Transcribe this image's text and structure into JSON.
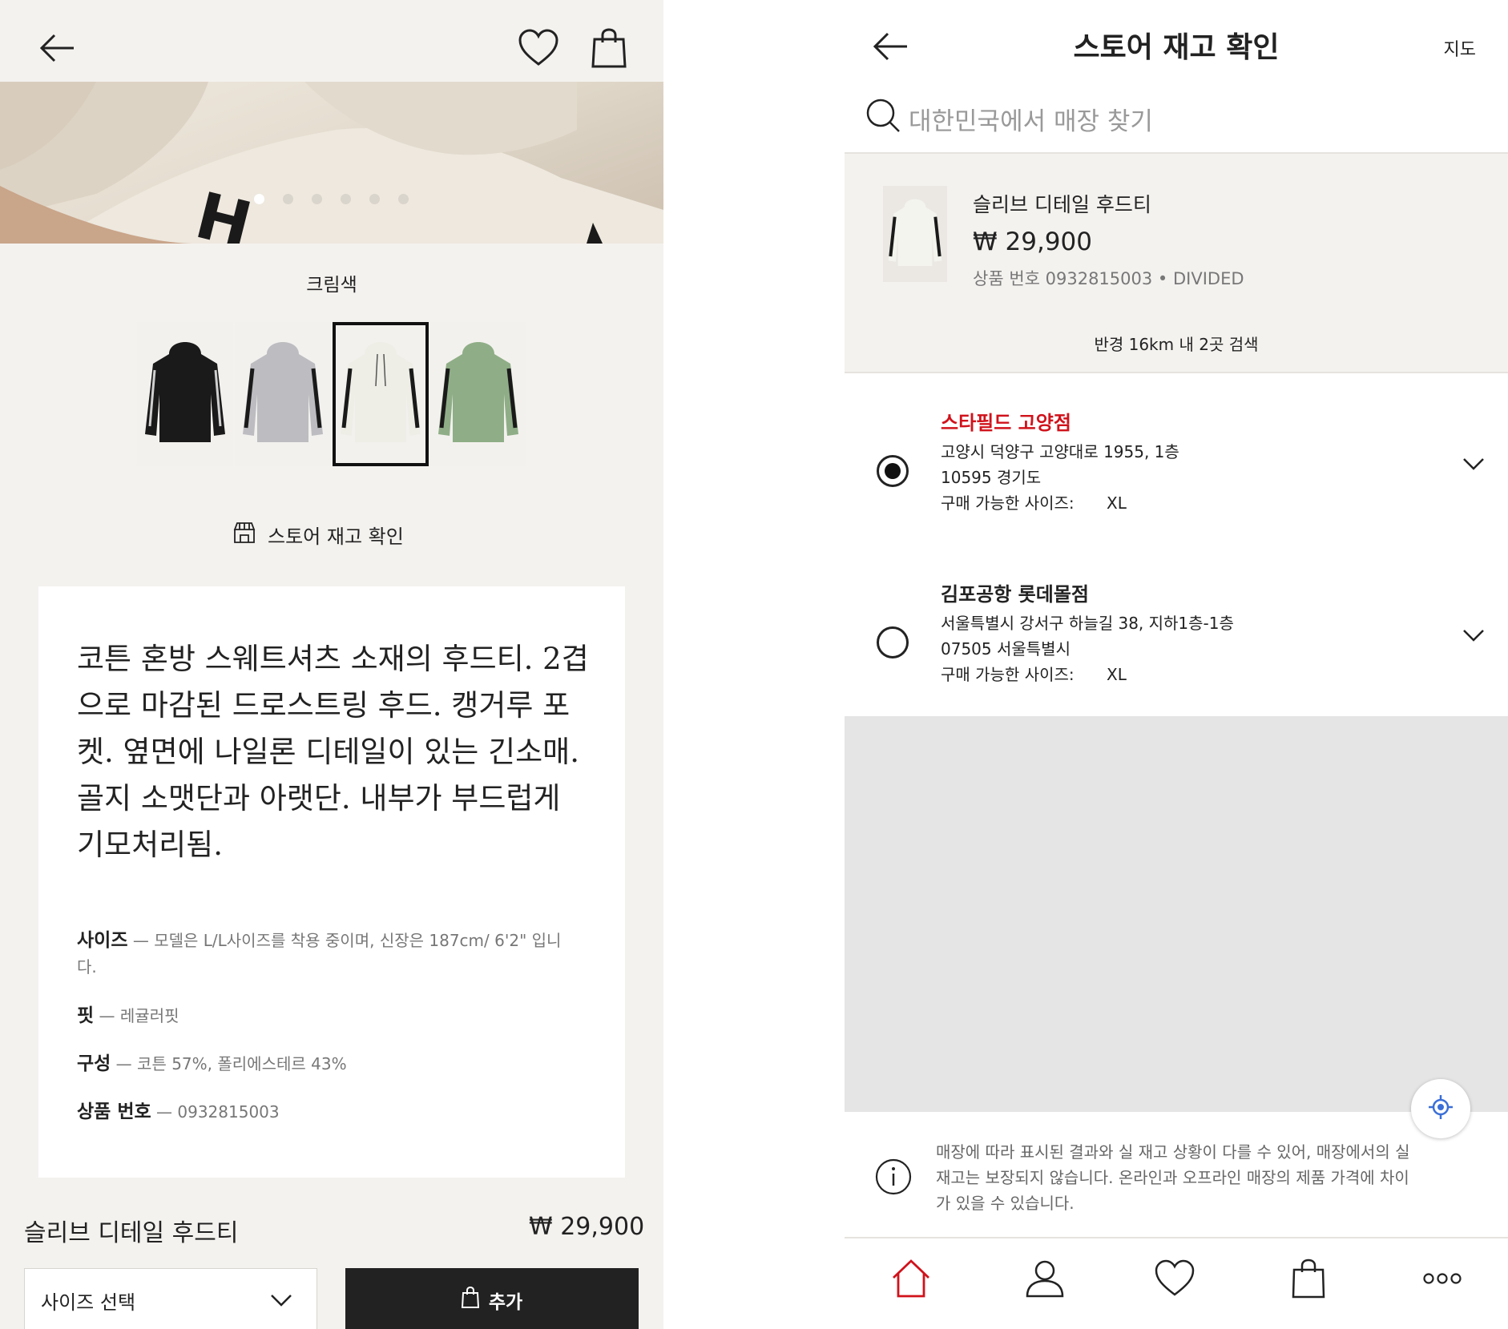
{
  "left": {
    "color_name": "크림색",
    "store_check_label": "스토어 재고 확인",
    "description": "코튼 혼방 스웨트셔츠 소재의 후드티. 2겹으로 마감된 드로스트링 후드. 캥거루 포켓. 옆면에 나일론 디테일이 있는 긴소매. 골지 소맷단과 아랫단. 내부가 부드럽게 기모처리됨.",
    "specs": [
      {
        "key": "사이즈",
        "value": "모델은  L/L사이즈를 착용 중이며, 신장은  187cm/ 6'2\" 입니다."
      },
      {
        "key": "핏",
        "value": "레귤러핏"
      },
      {
        "key": "구성",
        "value": "코튼 57%, 폴리에스테르 43%"
      },
      {
        "key": "상품 번호",
        "value": "0932815003"
      }
    ],
    "product_name": "슬리브 디테일 후드티",
    "price": "₩ 29,900",
    "size_select": "사이즈 선택",
    "add_button": "추가",
    "carousel_active_index": 0,
    "carousel_count": 6,
    "swatches": [
      {
        "color": "#1a1a1a",
        "selected": false
      },
      {
        "color": "#bcbcc0",
        "selected": false
      },
      {
        "color": "#eeeee6",
        "selected": true
      },
      {
        "color": "#8fae87",
        "selected": false
      }
    ]
  },
  "right": {
    "title": "스토어 재고 확인",
    "map_label": "지도",
    "search_placeholder": "대한민국에서 매장 찾기",
    "product": {
      "name": "슬리브 디테일 후드티",
      "price": "₩ 29,900",
      "meta": "상품 번호 0932815003 • DIVIDED"
    },
    "radius_text": "반경 16km 내 2곳 검색",
    "stores": [
      {
        "name": "스타필드 고양점",
        "address1": "고양시 덕양구 고양대로 1955, 1층",
        "address2": "10595 경기도",
        "sizes_label": "구매 가능한 사이즈:",
        "sizes": "XL",
        "selected": true
      },
      {
        "name": "김포공항 롯데몰점",
        "address1": "서울특별시 강서구 하늘길 38, 지하1층-1층",
        "address2": "07505 서울특별시",
        "sizes_label": "구매 가능한 사이즈:",
        "sizes": "XL",
        "selected": false
      }
    ],
    "info_text": "매장에 따라 표시된 결과와 실 재고 상황이 다를 수 있어, 매장에서의 실 재고는 보장되지 않습니다. 온라인과 오프라인 매장의 제품 가격에 차이가 있을 수 있습니다.",
    "tabs": [
      "home-icon",
      "account-icon",
      "favorites-icon",
      "bag-icon",
      "more-icon"
    ],
    "accent_color": "#d0121b"
  }
}
